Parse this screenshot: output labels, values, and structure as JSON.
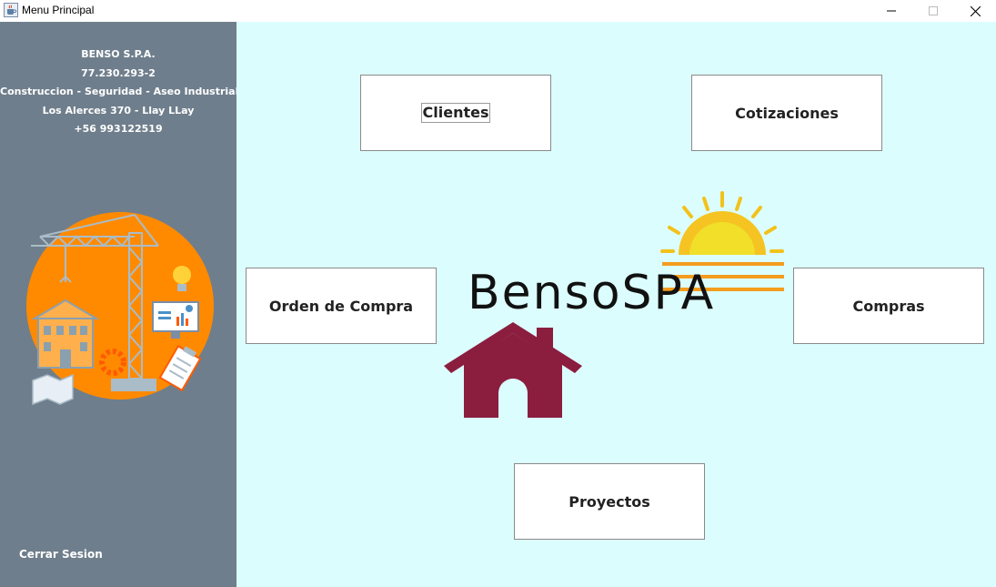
{
  "window": {
    "title": "Menu Principal",
    "icon": "java-cup-icon",
    "controls": {
      "minimize": "—",
      "maximize": "☐",
      "close": "✕"
    }
  },
  "sidebar": {
    "company_name": "BENSO S.P.A.",
    "rut": "77.230.293-2",
    "description": "Construccion - Seguridad - Aseo Industrial",
    "address": "Los Alerces 370 - Llay LLay",
    "phone": "+56 993122519",
    "illustration": "construction-illustration",
    "logout_label": "Cerrar Sesion"
  },
  "menu": {
    "clientes": "Clientes",
    "cotizaciones": "Cotizaciones",
    "orden_compra": "Orden de Compra",
    "compras": "Compras",
    "proyectos": "Proyectos"
  },
  "logo": {
    "text": "BensoSPA",
    "icons": [
      "sun-icon",
      "house-icon"
    ]
  },
  "colors": {
    "sidebar_bg": "#6f7e8c",
    "main_bg": "#dcfdfd",
    "house": "#8b1e3f",
    "sun": "#f0c419",
    "illustration_circle": "#ff8a00"
  }
}
